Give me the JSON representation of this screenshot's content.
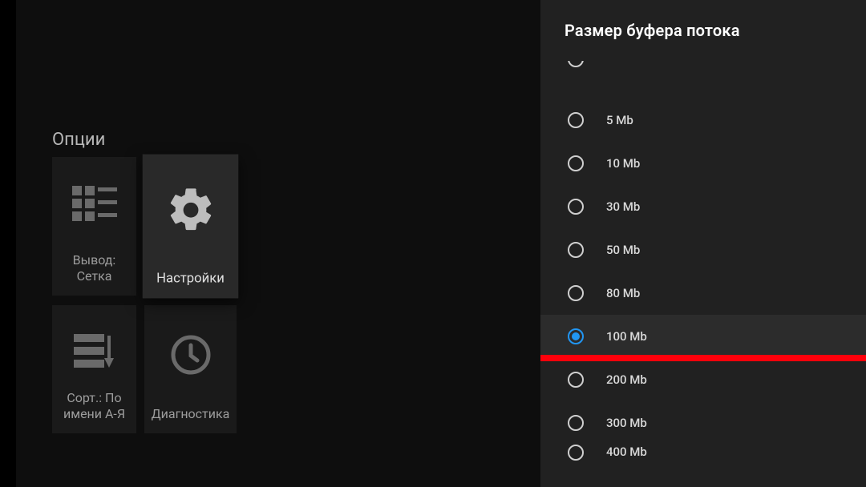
{
  "heading": "Опции",
  "tiles": [
    {
      "id": "output-grid",
      "icon": "grid-icon",
      "label": "Вывод:\nСетка",
      "focused": false
    },
    {
      "id": "settings",
      "icon": "gear-icon",
      "label": "Настройки",
      "focused": true
    },
    {
      "id": "sort-name",
      "icon": "sort-icon",
      "label": "Сорт.: По\nимени A-Я",
      "focused": false
    },
    {
      "id": "diagnostics",
      "icon": "clock-icon",
      "label": "Диагностика",
      "focused": false
    }
  ],
  "panel": {
    "title": "Размер буфера потока",
    "selected_index": 5,
    "options": [
      {
        "label": ""
      },
      {
        "label": "5 Mb"
      },
      {
        "label": "10 Mb"
      },
      {
        "label": "30 Mb"
      },
      {
        "label": "50 Mb"
      },
      {
        "label": "80 Mb"
      },
      {
        "label": "100 Mb"
      },
      {
        "label": "200 Mb"
      },
      {
        "label": "300 Mb"
      },
      {
        "label": "400 Mb"
      }
    ]
  },
  "colors": {
    "accent": "#2196f3",
    "highlight_bar": "#ff000b"
  }
}
